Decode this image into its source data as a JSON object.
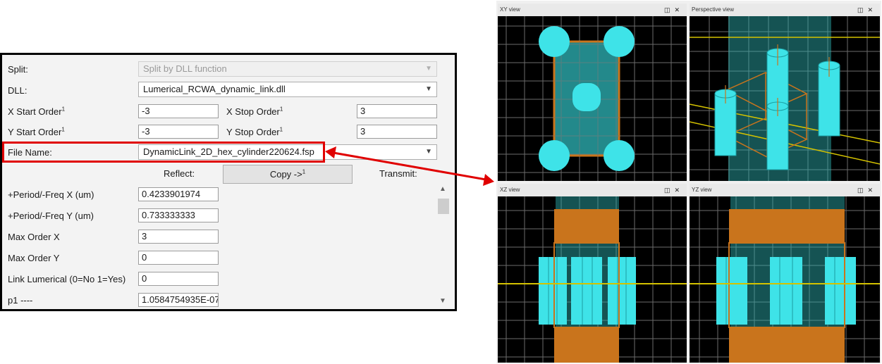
{
  "dialog": {
    "split_label": "Split:",
    "split_value": "Split by DLL function",
    "dll_label": "DLL:",
    "dll_value": "Lumerical_RCWA_dynamic_link.dll",
    "x_start_label": "X Start Order",
    "x_start_value": "-3",
    "x_stop_label": "X Stop Order",
    "x_stop_value": "3",
    "y_start_label": "Y Start Order",
    "y_start_value": "-3",
    "y_stop_label": "Y Stop Order",
    "y_stop_value": "3",
    "superscript": "1",
    "file_name_label": "File Name:",
    "file_name_value": "DynamicLink_2D_hex_cylinder220624.fsp",
    "reflect_label": "Reflect:",
    "copy_button": "Copy ->",
    "transmit_label": "Transmit:",
    "params": [
      {
        "label": "+Period/-Freq X (um)",
        "value": "0.4233901974"
      },
      {
        "label": "+Period/-Freq Y (um)",
        "value": "0.733333333"
      },
      {
        "label": "Max Order X",
        "value": "3"
      },
      {
        "label": "Max Order Y",
        "value": "0"
      },
      {
        "label": "Link Lumerical (0=No 1=Yes)",
        "value": "0"
      },
      {
        "label": "p1 ----",
        "value": "1.0584754935E-07"
      }
    ]
  },
  "views": {
    "xy_title": "XY view",
    "perspective_title": "Perspective view",
    "xz_title": "XZ view",
    "yz_title": "YZ view",
    "restore_icon": "restore-window-icon",
    "close_icon": "close-icon"
  },
  "colors": {
    "highlight": "#e00000",
    "cylinder": "#35e6ea",
    "substrate_orange": "#c9741c",
    "monitor_yellow": "#d4c200",
    "grid": "#6b6b6b"
  }
}
